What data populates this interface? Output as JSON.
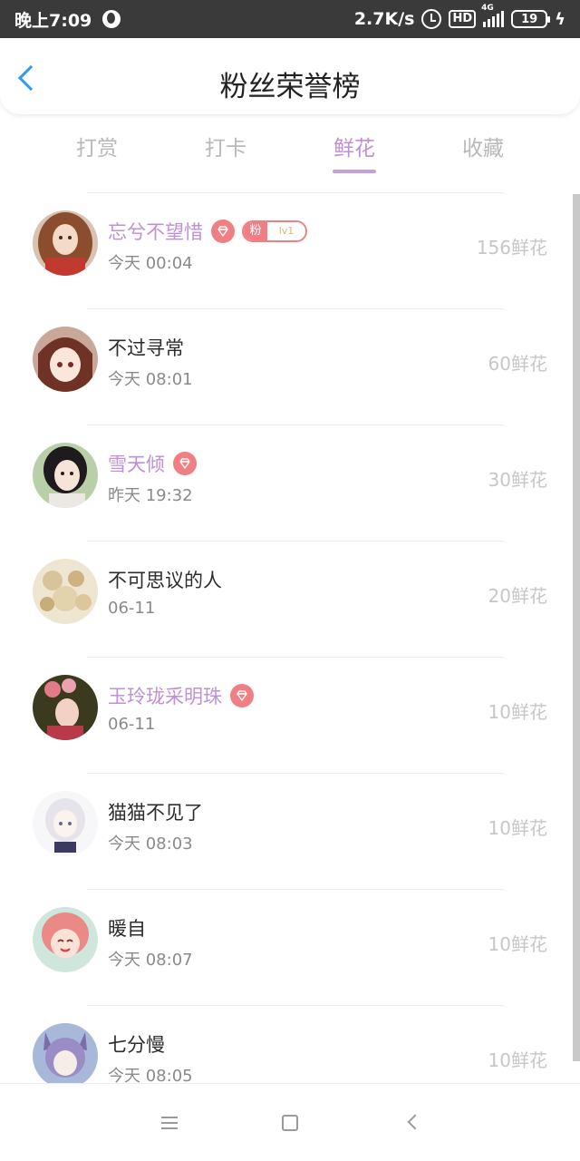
{
  "status_bar": {
    "time": "晚上7:09",
    "speed": "2.7K/s",
    "hd": "HD",
    "network": "4G",
    "battery": "19"
  },
  "header": {
    "title": "粉丝荣誉榜"
  },
  "tabs": [
    {
      "label": "打赏",
      "active": false
    },
    {
      "label": "打卡",
      "active": false
    },
    {
      "label": "鲜花",
      "active": true
    },
    {
      "label": "收藏",
      "active": false
    }
  ],
  "fans": [
    {
      "name": "忘兮不望惜",
      "vip": true,
      "fan_badge": {
        "label": "粉",
        "level": "lv1"
      },
      "time": "今天 00:04",
      "count": "156鲜花"
    },
    {
      "name": "不过寻常",
      "vip": false,
      "time": "今天 08:01",
      "count": "60鲜花"
    },
    {
      "name": "雪天倾",
      "vip": true,
      "time": "昨天 19:32",
      "count": "30鲜花"
    },
    {
      "name": "不可思议的人",
      "vip": false,
      "time": "06-11",
      "count": "20鲜花"
    },
    {
      "name": "玉玲珑采明珠",
      "vip": true,
      "time": "06-11",
      "count": "10鲜花"
    },
    {
      "name": "猫猫不见了",
      "vip": false,
      "time": "今天 08:03",
      "count": "10鲜花"
    },
    {
      "name": "暖自",
      "vip": false,
      "time": "今天 08:07",
      "count": "10鲜花"
    },
    {
      "name": "七分慢",
      "vip": false,
      "time": "今天 08:05",
      "count": "10鲜花"
    }
  ],
  "colors": {
    "accent": "#c08ed6",
    "back_arrow": "#2f9cef",
    "badge": "#f07f84"
  }
}
